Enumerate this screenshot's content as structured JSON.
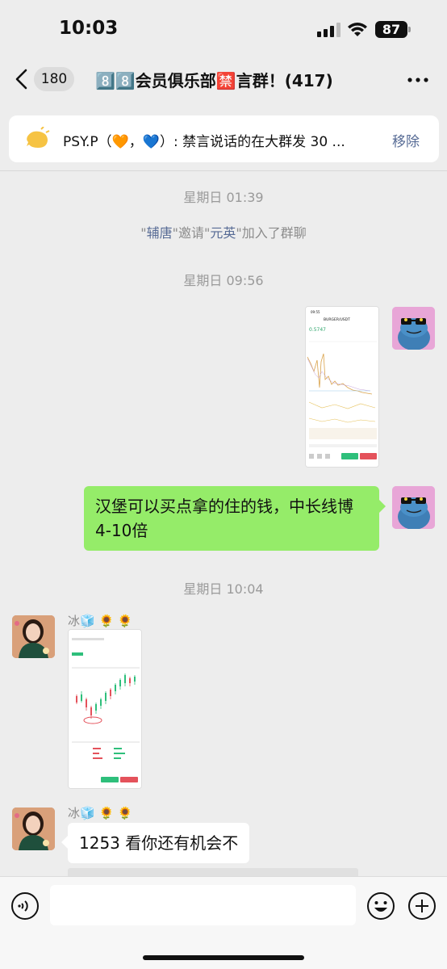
{
  "status_bar": {
    "time": "10:03",
    "battery": "87"
  },
  "nav": {
    "unread_count": "180",
    "title": "8️⃣8️⃣会员俱乐部🈲言群！(417)"
  },
  "pinned": {
    "text": "PSY.P（🧡，💙）: 禁言说话的在大群发 30 ...",
    "remove_label": "移除"
  },
  "messages": {
    "time1": "星期日 01:39",
    "system": {
      "q1": "\"",
      "name1": "辅唐",
      "mid": "\"邀请\"",
      "name2": "元英",
      "tail": "\"加入了群聊"
    },
    "time2": "星期日 09:56",
    "text1": "汉堡可以买点拿的住的钱，中长线博 4-10倍",
    "time3": "星期日 10:04",
    "sender1": "冰🧊 🌻 🌻",
    "sender2": "冰🧊 🌻 🌻",
    "text2": "1253 看你还有机会不"
  },
  "screenshot1": {
    "pair": "BURGER/USDT",
    "price": "0.5747"
  },
  "colors": {
    "bubble_green": "#95ec69",
    "link": "#576b95",
    "background": "#ededed"
  }
}
